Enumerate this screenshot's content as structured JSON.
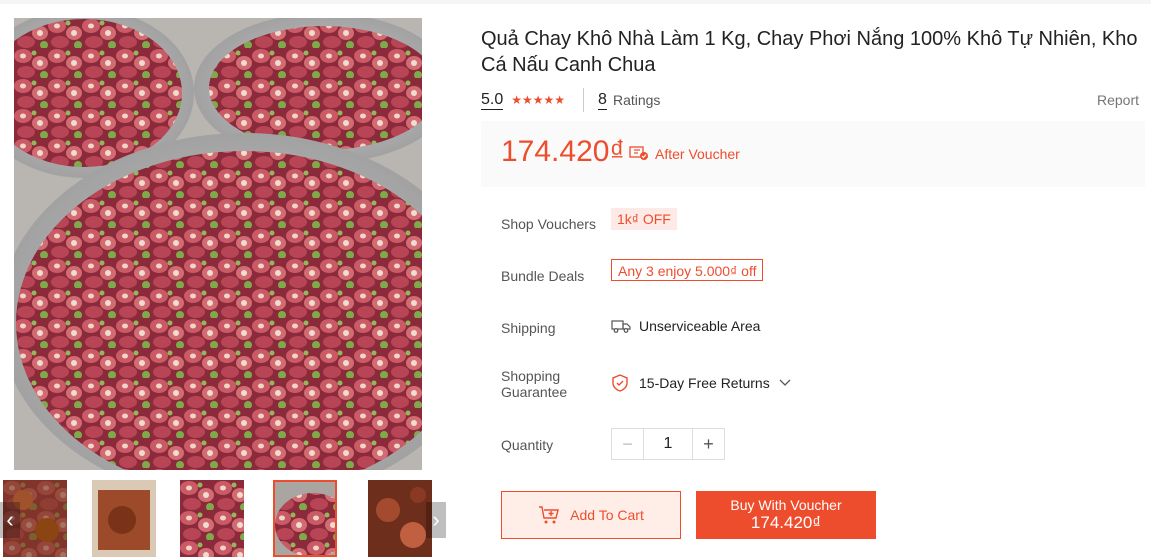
{
  "product": {
    "title": "Quả Chay Khô Nhà Làm 1 Kg, Chay Phơi Nắng 100% Khô Tự Nhiên, Kho Cá Nấu Canh Chua",
    "rating_value": "5.0",
    "stars": "★★★★★",
    "ratings_count": "8",
    "ratings_label": "Ratings",
    "report_label": "Report"
  },
  "price": {
    "amount": "174.420₫",
    "after_voucher_label": "After Voucher"
  },
  "shop_vouchers": {
    "label": "Shop Vouchers",
    "tag": "1k₫ OFF"
  },
  "bundle_deals": {
    "label": "Bundle Deals",
    "tag": "Any 3 enjoy 5.000₫ off"
  },
  "shipping": {
    "label": "Shipping",
    "value": "Unserviceable Area",
    "icon": "truck-icon"
  },
  "guarantee": {
    "label": "Shopping Guarantee",
    "value": "15-Day Free Returns",
    "icon": "shield-icon"
  },
  "quantity": {
    "label": "Quantity",
    "value": "1",
    "minus": "−",
    "plus": "+"
  },
  "actions": {
    "add_to_cart": "Add To Cart",
    "buy_with_voucher": "Buy With Voucher",
    "buy_price": "174.420₫"
  },
  "gallery": {
    "prev": "‹",
    "next": "›",
    "active_thumb_index": 3
  },
  "colors": {
    "accent": "#ee4d2d",
    "accent_light": "#ffeee8"
  }
}
